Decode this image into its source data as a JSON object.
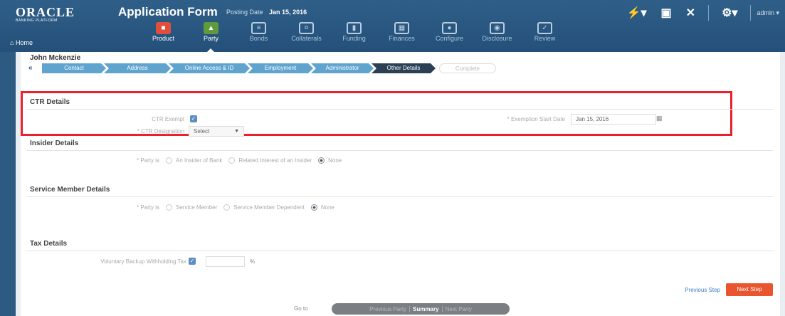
{
  "header": {
    "logo_line1": "ORACLE",
    "logo_line2": "BANKING PLATFORM",
    "title": "Application Form",
    "posting_label": "Posting Date",
    "posting_value": "Jan 15, 2016",
    "user": "admin",
    "home": "Home",
    "icons": [
      "magic-wand-icon",
      "save-icon",
      "close-icon",
      "gear-icon"
    ]
  },
  "tabs": [
    {
      "label": "Product",
      "icon": "box-icon"
    },
    {
      "label": "Party",
      "icon": "person-icon"
    },
    {
      "label": "Bonds",
      "icon": "document-icon"
    },
    {
      "label": "Collaterals",
      "icon": "collateral-icon"
    },
    {
      "label": "Funding",
      "icon": "funding-icon"
    },
    {
      "label": "Finances",
      "icon": "calculator-icon"
    },
    {
      "label": "Configure",
      "icon": "configure-icon"
    },
    {
      "label": "Disclosure",
      "icon": "disclosure-icon"
    },
    {
      "label": "Review",
      "icon": "review-icon"
    }
  ],
  "customer_name": "John Mckenzie",
  "train": {
    "steps": [
      "Contact",
      "Address",
      "Online Access & ID",
      "Employment",
      "Administrator",
      "Other Details",
      "Complete"
    ],
    "current": "Other Details"
  },
  "ctr": {
    "title": "CTR Details",
    "exempt_label": "CTR Exempt",
    "exempt_checked": true,
    "designation_label": "* CTR Designation",
    "designation_value": "Select",
    "start_date_label": "* Exemption Start Date",
    "start_date_value": "Jan 15, 2016"
  },
  "insider": {
    "title": "Insider Details",
    "party_label": "* Party is",
    "options": [
      "An Insider of Bank",
      "Related Interest of an Insider",
      "None"
    ],
    "selected": "None"
  },
  "service_member": {
    "title": "Service Member Details",
    "party_label": "* Party is",
    "options": [
      "Service Member",
      "Service Member Dependent",
      "None"
    ],
    "selected": "None"
  },
  "tax": {
    "title": "Tax Details",
    "withholding_label": "Voluntary Backup Withholding Tax",
    "withholding_checked": true,
    "percent_symbol": "%"
  },
  "nav": {
    "previous_label": "Previous Step",
    "next_label": "Next Step"
  },
  "footer": {
    "goto_label": "Go to",
    "previous_party": "Previous Party",
    "summary": "Summary",
    "next_party": "Next Party"
  },
  "colors": {
    "header_blue": "#2b5a82",
    "step_blue": "#5fa3cf",
    "step_current": "#2b3f55",
    "highlight_red": "#e8212b",
    "next_button": "#e8552f"
  }
}
